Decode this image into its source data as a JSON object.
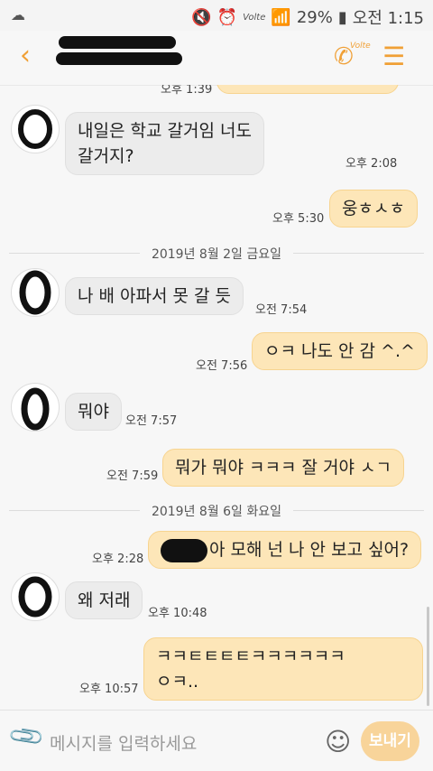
{
  "status": {
    "left_icon": "cloud-icon",
    "battery": "29%",
    "time": "오전 1:15",
    "volte": "Volte"
  },
  "header": {
    "back_icon": "chevron-left-icon",
    "call_icon": "volte-call-icon",
    "call_badge": "Volte",
    "menu_icon": "menu-icon"
  },
  "messages": [
    {
      "dir": "out",
      "text": "",
      "time": "오후 1:39"
    },
    {
      "dir": "in",
      "text1": "내일은 학교 갈거임 너도",
      "text2": "갈거지?",
      "time": "오후 2:08"
    },
    {
      "dir": "out",
      "text": "웅ㅎㅅㅎ",
      "time": "오후 5:30"
    },
    {
      "dir": "date",
      "text": "2019년 8월 2일 금요일"
    },
    {
      "dir": "in",
      "text": "나 배 아파서 못 갈 듯",
      "time": "오전 7:54"
    },
    {
      "dir": "out",
      "text": "ㅇㅋ 나도 안 감 ^.^",
      "time": "오전 7:56"
    },
    {
      "dir": "in",
      "text": "뭐야",
      "time": "오전 7:57"
    },
    {
      "dir": "out",
      "text": "뭐가 뭐야 ㅋㅋㅋ 잘 거야 ㅅㄱ",
      "time": "오전 7:59"
    },
    {
      "dir": "date",
      "text": "2019년 8월 6일 화요일"
    },
    {
      "dir": "out",
      "text": "아 모해 넌 나 안 보고 싶어?",
      "time": "오후 2:28"
    },
    {
      "dir": "in",
      "text": "왜 저래",
      "time": "오후 10:48"
    },
    {
      "dir": "out",
      "text1": "ㅋㅋㅌㅌㅌㅌㅋㅋㅋㅋㅋㅋ",
      "text2": "ㅇㅋ..",
      "time": "오후 10:57"
    }
  ],
  "input": {
    "placeholder": "메시지를 입력하세요",
    "send_label": "보내기",
    "attach_icon": "paperclip-icon",
    "emoji_icon": "smiley-icon"
  },
  "colors": {
    "accent": "#f0a036",
    "outgoing": "#fde6b8",
    "incoming": "#ececec"
  }
}
